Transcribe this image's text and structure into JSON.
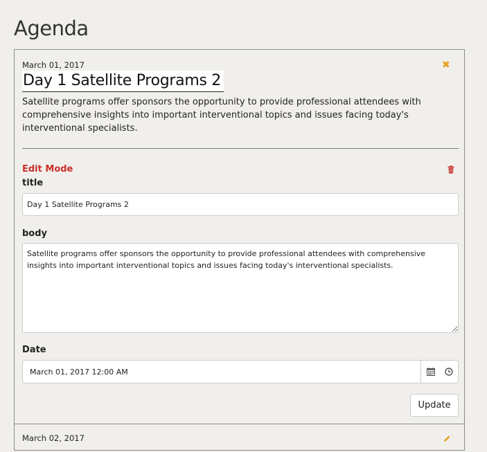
{
  "page": {
    "title": "Agenda"
  },
  "agenda_item": {
    "date": "March 01, 2017",
    "title": "Day 1 Satellite Programs 2",
    "body": "Satellite programs offer sponsors the opportunity to provide professional attendees with comprehensive insights into important interventional topics and issues facing today's interventional specialists.",
    "close_icon": "close-icon",
    "close_color": "#e6a020"
  },
  "edit_form": {
    "mode_label": "Edit Mode",
    "mode_color": "#c9302c",
    "delete_icon": "trash-icon",
    "title_label": "title",
    "title_value": "Day 1 Satellite Programs 2",
    "body_label": "body",
    "body_value": "Satellite programs offer sponsors the opportunity to provide professional attendees with comprehensive insights into important interventional topics and issues facing today's interventional specialists.",
    "date_label": "Date",
    "date_value": "March 01, 2017 12:00 AM",
    "calendar_icon": "calendar-icon",
    "clock_icon": "clock-icon",
    "update_label": "Update"
  },
  "next_item": {
    "date": "March 02, 2017",
    "edit_icon": "pencil-icon",
    "edit_color": "#e6a020"
  }
}
